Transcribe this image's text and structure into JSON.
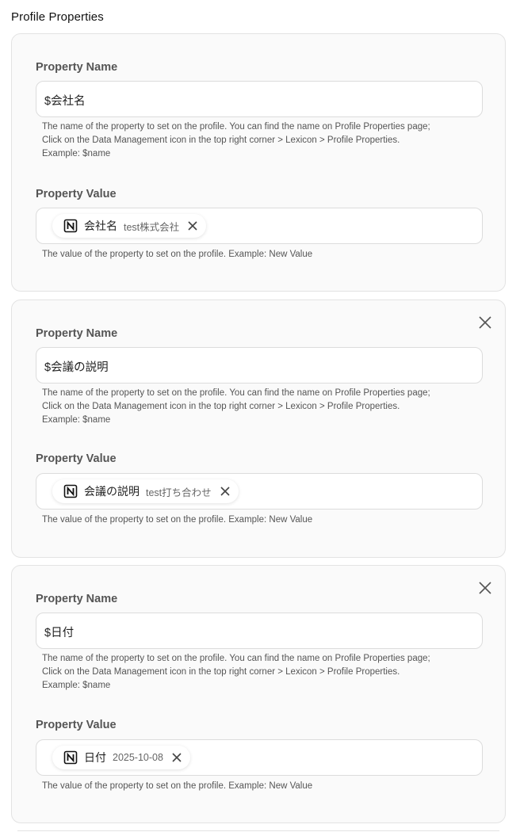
{
  "section_title": "Profile Properties",
  "labels": {
    "property_name": "Property Name",
    "property_value": "Property Value",
    "name_help_1": "The name of the property to set on the profile. You can find the name on Profile Properties page;",
    "name_help_2": "Click on the Data Management icon in the top right corner > Lexicon > Profile Properties.",
    "name_help_3": "Example: $name",
    "value_help": "The value of the property to set on the profile. Example: New Value"
  },
  "properties": [
    {
      "name": "$会社名",
      "chip_label": "会社名",
      "chip_value": "test株式会社",
      "chip_icon": "notion-icon",
      "removable": false
    },
    {
      "name": "$会議の説明",
      "chip_label": "会議の説明",
      "chip_value": "test打ち合わせ",
      "chip_icon": "notion-icon",
      "removable": true
    },
    {
      "name": "$日付",
      "chip_label": "日付",
      "chip_value": "2025-10-08",
      "chip_icon": "notion-icon",
      "removable": true
    }
  ]
}
